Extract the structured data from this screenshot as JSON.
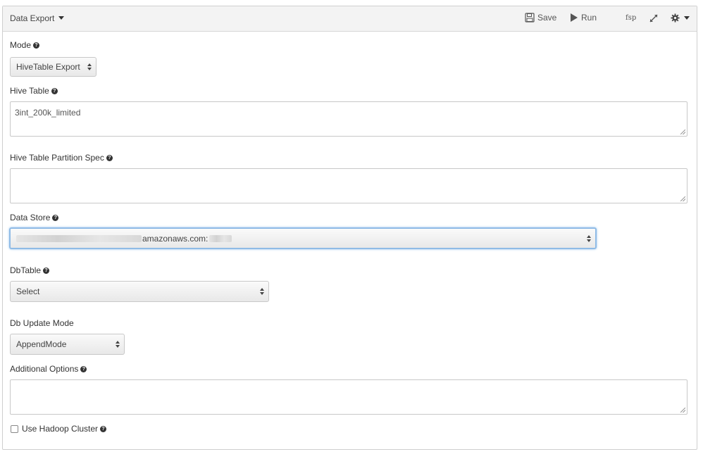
{
  "header": {
    "title": "Data Export",
    "save_label": "Save",
    "run_label": "Run",
    "fsp_label": "fsp"
  },
  "form": {
    "mode": {
      "label": "Mode",
      "value": "HiveTable Export"
    },
    "hive_table": {
      "label": "Hive Table",
      "value": "3int_200k_limited"
    },
    "partition_spec": {
      "label": "Hive Table Partition Spec",
      "value": ""
    },
    "data_store": {
      "label": "Data Store",
      "value_suffix": "amazonaws.com:"
    },
    "db_table": {
      "label": "DbTable",
      "value": "Select"
    },
    "db_update_mode": {
      "label": "Db Update Mode",
      "value": "AppendMode"
    },
    "additional_options": {
      "label": "Additional Options",
      "value": ""
    },
    "use_hadoop_cluster": {
      "label": "Use Hadoop Cluster",
      "checked": false
    }
  },
  "icons": {
    "help": "question-circle-icon",
    "save": "floppy-disk-icon",
    "run": "play-icon",
    "expand": "expand-icon",
    "settings": "gear-icon"
  }
}
